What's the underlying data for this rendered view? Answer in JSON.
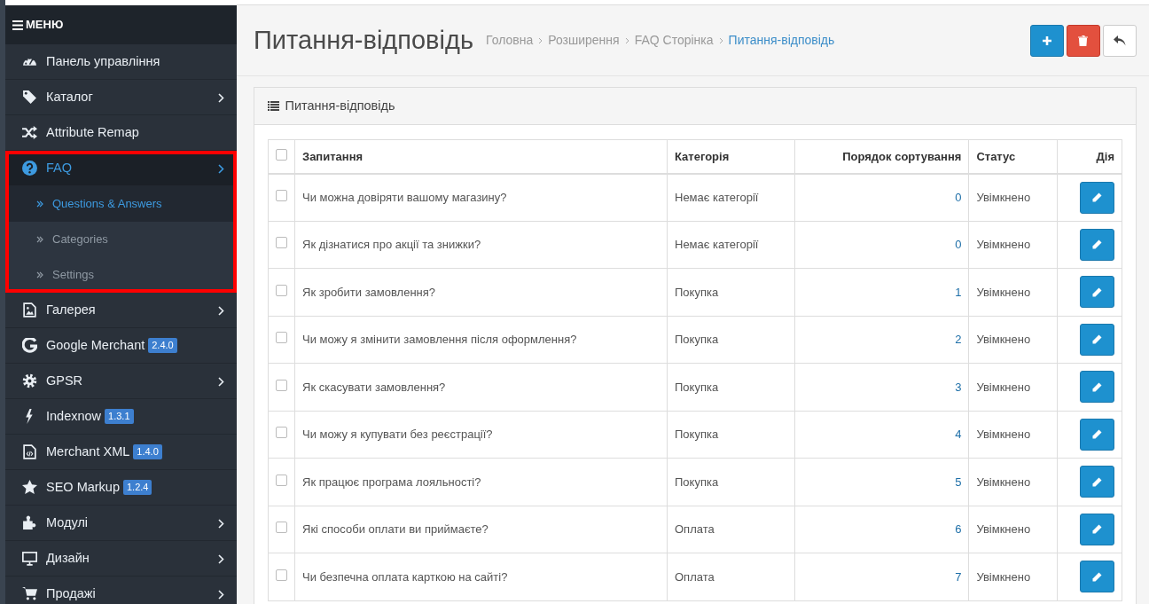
{
  "sidebar": {
    "header": "МЕНЮ",
    "items": [
      {
        "label": "Панель управління",
        "arrow": false,
        "selected": false
      },
      {
        "label": "Каталог",
        "arrow": true,
        "selected": false
      },
      {
        "label": "Attribute Remap",
        "arrow": false,
        "selected": false
      },
      {
        "label": "FAQ",
        "arrow": true,
        "selected": true,
        "highlighted": true,
        "children": [
          {
            "label": "Questions & Answers",
            "selected": true
          },
          {
            "label": "Categories",
            "selected": false
          },
          {
            "label": "Settings",
            "selected": false
          }
        ]
      },
      {
        "label": "Галерея",
        "arrow": true,
        "selected": false
      },
      {
        "label": "Google Merchant",
        "badge": "2.4.0",
        "arrow": false,
        "selected": false
      },
      {
        "label": "GPSR",
        "arrow": true,
        "selected": false
      },
      {
        "label": "Indexnow",
        "badge": "1.3.1",
        "arrow": false,
        "selected": false
      },
      {
        "label": "Merchant XML",
        "badge": "1.4.0",
        "arrow": false,
        "selected": false
      },
      {
        "label": "SEO Markup",
        "badge": "1.2.4",
        "arrow": false,
        "selected": false
      },
      {
        "label": "Модулі",
        "arrow": true,
        "selected": false
      },
      {
        "label": "Дизайн",
        "arrow": true,
        "selected": false
      },
      {
        "label": "Продажі",
        "arrow": true,
        "selected": false
      }
    ]
  },
  "page": {
    "title": "Питання-відповідь",
    "breadcrumbs": [
      {
        "label": "Головна",
        "selected": false
      },
      {
        "label": "Розширення",
        "selected": false
      },
      {
        "label": "FAQ Сторінка",
        "selected": false
      },
      {
        "label": "Питання-відповідь",
        "selected": true
      }
    ]
  },
  "panel": {
    "title": "Питання-відповідь"
  },
  "table": {
    "select_all_checked": false,
    "columns": [
      "Запитання",
      "Категорія",
      "Порядок сортування",
      "Статус",
      "Дія"
    ],
    "rows": [
      {
        "checked": false,
        "question": "Чи можна довіряти вашому магазину?",
        "category": "Немає категорії",
        "sort": "0",
        "status": "Увімкнено"
      },
      {
        "checked": false,
        "question": "Як дізнатися про акції та знижки?",
        "category": "Немає категорії",
        "sort": "0",
        "status": "Увімкнено"
      },
      {
        "checked": false,
        "question": "Як зробити замовлення?",
        "category": "Покупка",
        "sort": "1",
        "status": "Увімкнено"
      },
      {
        "checked": false,
        "question": "Чи можу я змінити замовлення після оформлення?",
        "category": "Покупка",
        "sort": "2",
        "status": "Увімкнено"
      },
      {
        "checked": false,
        "question": "Як скасувати замовлення?",
        "category": "Покупка",
        "sort": "3",
        "status": "Увімкнено"
      },
      {
        "checked": false,
        "question": "Чи можу я купувати без реєстрації?",
        "category": "Покупка",
        "sort": "4",
        "status": "Увімкнено"
      },
      {
        "checked": false,
        "question": "Як працює програма лояльності?",
        "category": "Покупка",
        "sort": "5",
        "status": "Увімкнено"
      },
      {
        "checked": false,
        "question": "Які способи оплати ви приймаєте?",
        "category": "Оплата",
        "sort": "6",
        "status": "Увімкнено"
      },
      {
        "checked": false,
        "question": "Чи безпечна оплата карткою на сайті?",
        "category": "Оплата",
        "sort": "7",
        "status": "Увімкнено"
      }
    ]
  }
}
